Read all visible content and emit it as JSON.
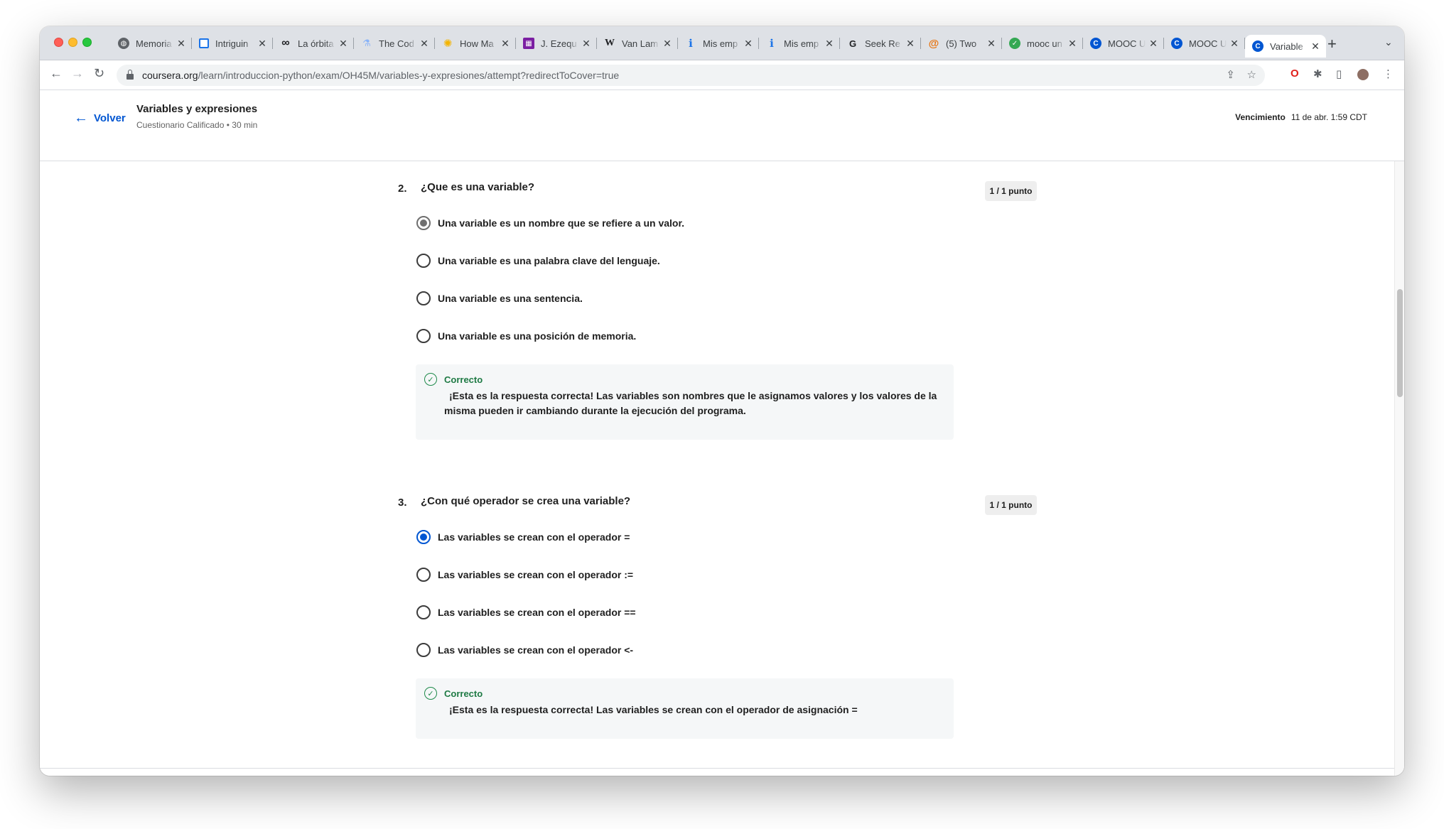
{
  "browser": {
    "tabs": [
      {
        "title": "Memoria",
        "icon": "globe-icon",
        "color": "#5f6368"
      },
      {
        "title": "Intriguin",
        "icon": "trello-icon",
        "color": "#1a73e8"
      },
      {
        "title": "La órbita",
        "icon": "infinity-icon",
        "color": "#202124"
      },
      {
        "title": "The Cod",
        "icon": "flask-icon",
        "color": "#8ab4f8"
      },
      {
        "title": "How Ma",
        "icon": "sun-icon",
        "color": "#f4b400"
      },
      {
        "title": "J. Ezequ",
        "icon": "pixel-icon",
        "color": "#7b1fa2"
      },
      {
        "title": "Van Lam",
        "icon": "wikipedia-icon",
        "color": "#202124"
      },
      {
        "title": "Mis emp",
        "icon": "info-icon",
        "color": "#1a73e8"
      },
      {
        "title": "Mis emp",
        "icon": "info-icon",
        "color": "#1a73e8"
      },
      {
        "title": "Seek Re",
        "icon": "g-icon",
        "color": "#202124"
      },
      {
        "title": "(5) Two",
        "icon": "swirl-icon",
        "color": "#e8710a"
      },
      {
        "title": "mooc un",
        "icon": "leaf-icon",
        "color": "#34a853"
      },
      {
        "title": "MOOC U",
        "icon": "coursera-icon",
        "color": "#0056d2"
      },
      {
        "title": "MOOC U",
        "icon": "coursera-icon",
        "color": "#0056d2"
      },
      {
        "title": "Variable",
        "icon": "coursera-icon",
        "color": "#0056d2"
      }
    ],
    "url_host": "coursera.org",
    "url_path": "/learn/introduccion-python/exam/OH45M/variables-y-expresiones/attempt?redirectToCover=true"
  },
  "header": {
    "back_label": "Volver",
    "title": "Variables y expresiones",
    "subtitle": "Cuestionario Calificado • 30 min",
    "due_label": "Vencimiento",
    "due_value": "11 de abr. 1:59 CDT"
  },
  "questions": [
    {
      "number": "2.",
      "text": "¿Que es una variable?",
      "points": "1 / 1 punto",
      "options": [
        "Una variable es un nombre que se refiere a un valor.",
        "Una variable es una palabra clave del lenguaje.",
        "Una variable es una sentencia.",
        "Una variable es una posición de memoria."
      ],
      "selected_index": 0,
      "feedback_status": "Correcto",
      "feedback_text": "¡Esta es la respuesta correcta! Las variables son nombres que le asignamos valores y los valores de la misma pueden ir cambiando durante la ejecución del programa."
    },
    {
      "number": "3.",
      "text": "¿Con qué operador se crea una variable?",
      "points": "1 / 1 punto",
      "options": [
        "Las variables se crean con el operador =",
        "Las variables se crean con el operador :=",
        "Las variables se crean con el operador ==",
        "Las variables se crean con el operador <-"
      ],
      "selected_index": 0,
      "feedback_status": "Correcto",
      "feedback_text": "¡Esta es la respuesta correcta! Las variables se crean con el operador de asignación ="
    }
  ],
  "colors": {
    "accent": "#0056d2",
    "success": "#1e7a44"
  }
}
